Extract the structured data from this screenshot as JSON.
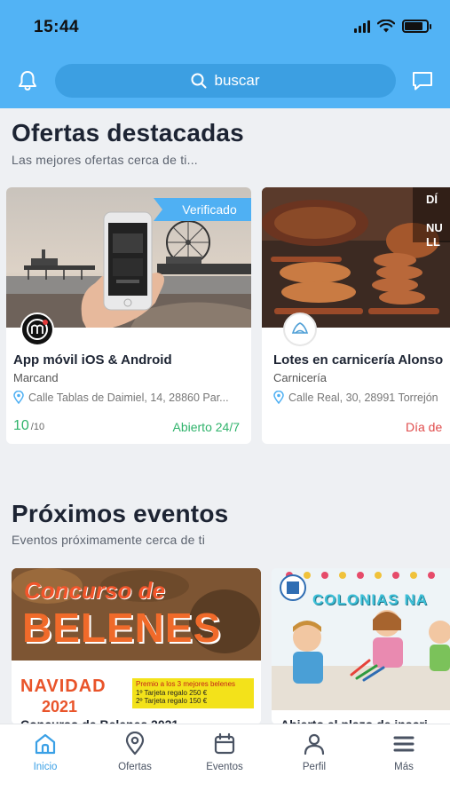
{
  "status_bar": {
    "time": "15:44",
    "battery_level": 0.85
  },
  "header": {
    "search_placeholder": "buscar"
  },
  "featured": {
    "title": "Ofertas destacadas",
    "subtitle": "Las mejores ofertas cerca de ti...",
    "cards": [
      {
        "title": "App móvil iOS & Android",
        "category": "Marcand",
        "address": "Calle Tablas de Daimiel, 14, 28860 Par...",
        "badge": "Verificado",
        "rating": "10",
        "rating_max": "/10",
        "status": "Abierto 24/7"
      },
      {
        "title": "Lotes en carnicería Alonso",
        "category": "Carnicería",
        "address": "Calle Real, 30, 28991 Torrejón",
        "status": "Día de"
      }
    ]
  },
  "events": {
    "title": "Próximos eventos",
    "subtitle": "Eventos próximamente cerca de ti",
    "cards": [
      {
        "poster_title_1": "Concurso de",
        "poster_title_2": "BELENES",
        "poster_line": "NAVIDAD",
        "poster_year": "2021",
        "prize_heading": "Premio a los 3 mejores belenes",
        "prize_1": "1º  Tarjeta regalo  250 €",
        "prize_2": "2º  Tarjeta regalo  150 €",
        "caption": "Concurso de Belenes 2021"
      },
      {
        "poster_title": "COLONIAS NA",
        "caption": "Abierto el plazo de inscri"
      }
    ]
  },
  "tabbar": {
    "items": [
      {
        "label": "Inicio",
        "icon": "home-icon",
        "active": true
      },
      {
        "label": "Ofertas",
        "icon": "location-pin-icon",
        "active": false
      },
      {
        "label": "Eventos",
        "icon": "calendar-icon",
        "active": false
      },
      {
        "label": "Perfil",
        "icon": "user-icon",
        "active": false
      },
      {
        "label": "Más",
        "icon": "menu-icon",
        "active": false
      }
    ]
  },
  "colors": {
    "header": "#52b3f5",
    "search_bg": "#3c9fe2",
    "accent": "#3aa0e6",
    "open_green": "#2fb36b",
    "closed_red": "#e04b4b"
  }
}
